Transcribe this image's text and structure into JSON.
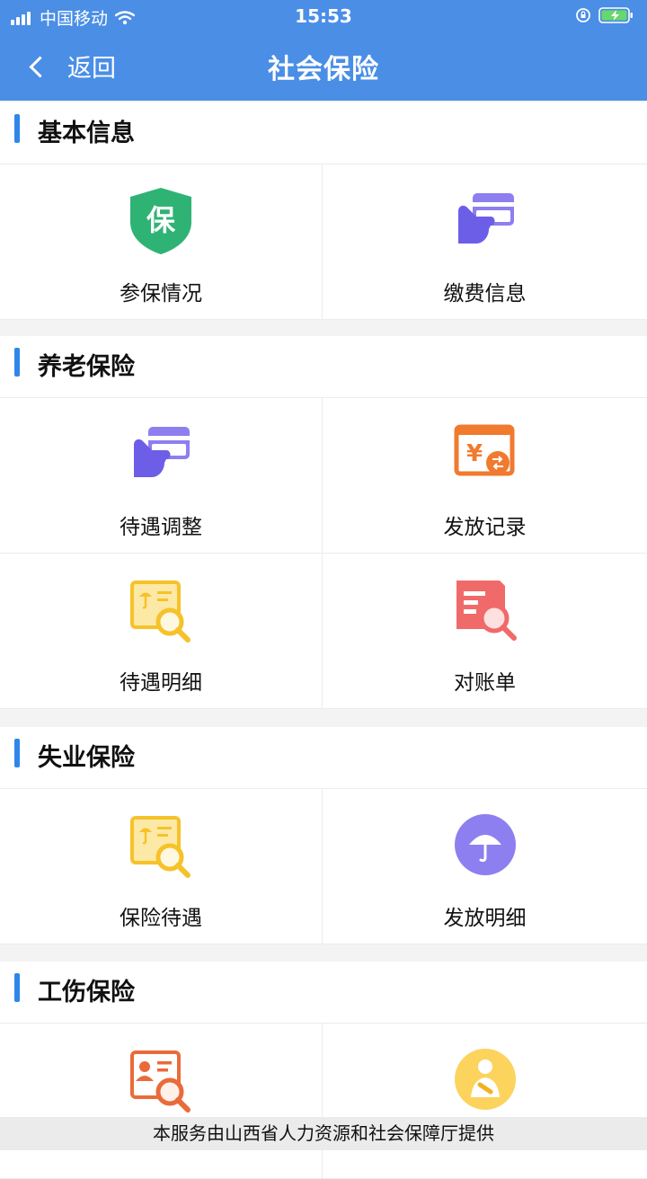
{
  "status_bar": {
    "carrier": "中国移动",
    "time": "15:53"
  },
  "nav": {
    "back_label": "返回",
    "title": "社会保险"
  },
  "sections": [
    {
      "title": "基本信息",
      "items": [
        {
          "label": "参保情况",
          "icon": "shield-bao-icon"
        },
        {
          "label": "缴费信息",
          "icon": "card-hand-icon"
        }
      ]
    },
    {
      "title": "养老保险",
      "items": [
        {
          "label": "待遇调整",
          "icon": "card-hand-icon"
        },
        {
          "label": "发放记录",
          "icon": "yuan-transfer-icon"
        },
        {
          "label": "待遇明细",
          "icon": "umbrella-doc-search-icon"
        },
        {
          "label": "对账单",
          "icon": "doc-search-icon"
        }
      ]
    },
    {
      "title": "失业保险",
      "items": [
        {
          "label": "保险待遇",
          "icon": "umbrella-doc-search-icon"
        },
        {
          "label": "发放明细",
          "icon": "umbrella-circle-icon"
        }
      ]
    },
    {
      "title": "工伤保险",
      "items": [
        {
          "icon": "id-card-search-icon"
        },
        {
          "icon": "injured-person-icon"
        }
      ]
    }
  ],
  "footer": {
    "text": "本服务由山西省人力资源和社会保障厅提供"
  }
}
